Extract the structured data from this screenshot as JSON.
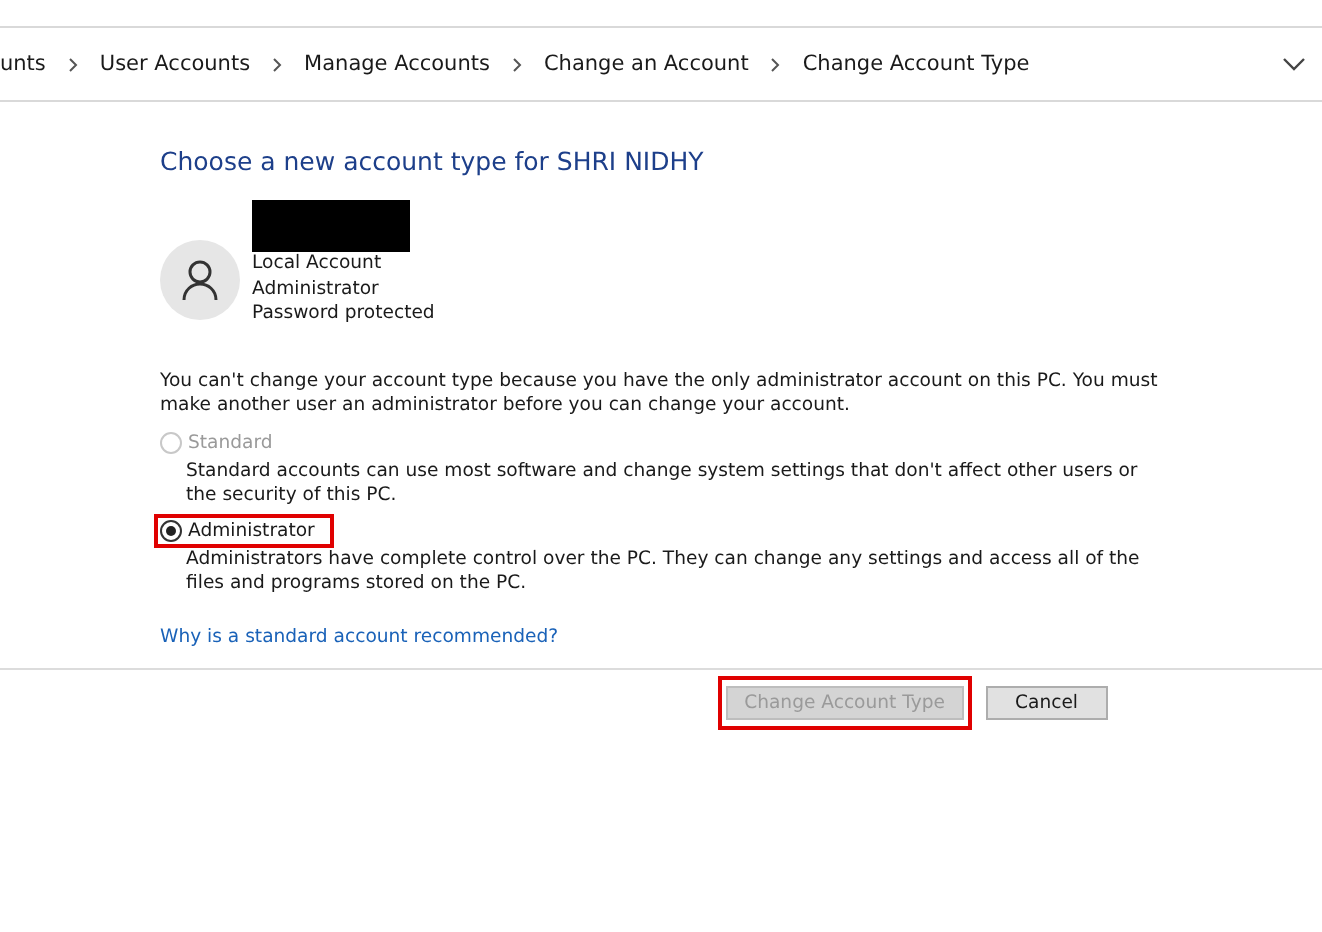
{
  "breadcrumb": [
    "unts",
    "User Accounts",
    "Manage Accounts",
    "Change an Account",
    "Change Account Type"
  ],
  "title": "Choose a new account type for SHRI NIDHY",
  "account": {
    "redacted": true,
    "details": [
      "Local Account",
      "Administrator",
      "Password protected"
    ]
  },
  "message": "You can't change your account type because you have the only administrator account on this PC. You must make another user an administrator before you can change your account.",
  "options": [
    {
      "label": "Standard",
      "description": "Standard accounts can use most software and change system settings that don't affect other users or the security of this PC.",
      "selected": false,
      "disabled": true,
      "highlighted": false
    },
    {
      "label": "Administrator",
      "description": "Administrators have complete control over the PC. They can change any settings and access all of the files and programs stored on the PC.",
      "selected": true,
      "disabled": false,
      "highlighted": true
    }
  ],
  "link": "Why is a standard account recommended?",
  "buttons": [
    {
      "label": "Change Account Type",
      "disabled": true,
      "highlighted": true
    },
    {
      "label": "Cancel",
      "disabled": false,
      "highlighted": false
    }
  ]
}
